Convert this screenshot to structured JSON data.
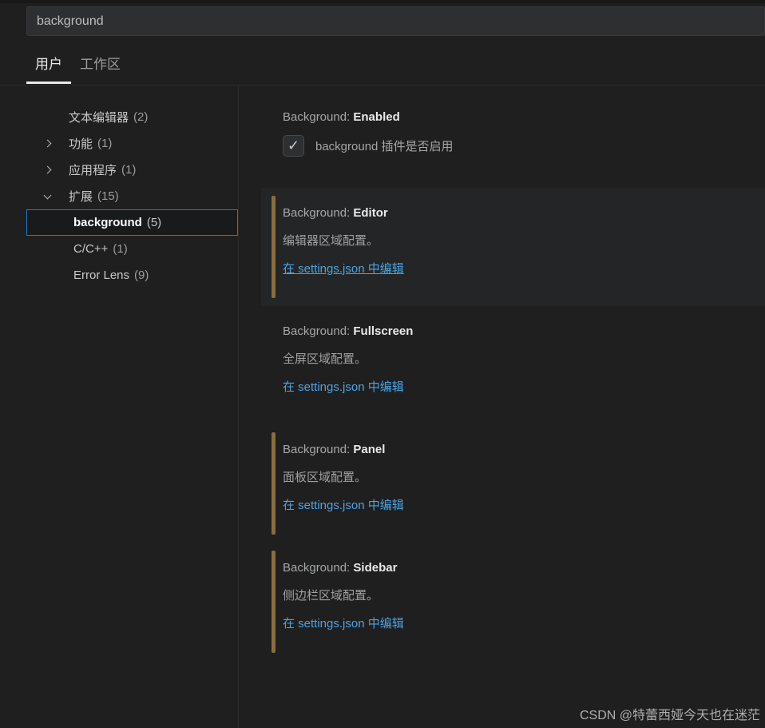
{
  "search": {
    "value": "background"
  },
  "tabs": [
    {
      "label": "用户",
      "active": true
    },
    {
      "label": "工作区",
      "active": false
    }
  ],
  "toc": {
    "items": [
      {
        "label": "文本编辑器",
        "count": "(2)",
        "chevron": "none",
        "level": 0,
        "selected": false
      },
      {
        "label": "功能",
        "count": "(1)",
        "chevron": "right",
        "level": 0,
        "selected": false
      },
      {
        "label": "应用程序",
        "count": "(1)",
        "chevron": "right",
        "level": 0,
        "selected": false
      },
      {
        "label": "扩展",
        "count": "(15)",
        "chevron": "down",
        "level": 0,
        "selected": false
      },
      {
        "label": "background",
        "count": "(5)",
        "chevron": "none",
        "level": 1,
        "selected": true
      },
      {
        "label": "C/C++",
        "count": "(1)",
        "chevron": "none",
        "level": 1,
        "selected": false
      },
      {
        "label": "Error Lens",
        "count": "(9)",
        "chevron": "none",
        "level": 1,
        "selected": false
      }
    ]
  },
  "settings": [
    {
      "category": "Background: ",
      "name": "Enabled",
      "type": "checkbox",
      "checkbox_label": "background 插件是否启用",
      "checked": true,
      "check_glyph": "✓",
      "modified": false,
      "focused": false
    },
    {
      "category": "Background: ",
      "name": "Editor",
      "type": "link",
      "description": "编辑器区域配置。",
      "link_label": "在 settings.json 中编辑",
      "modified": true,
      "focused": true
    },
    {
      "category": "Background: ",
      "name": "Fullscreen",
      "type": "link",
      "description": "全屏区域配置。",
      "link_label": "在 settings.json 中编辑",
      "modified": false,
      "focused": false
    },
    {
      "category": "Background: ",
      "name": "Panel",
      "type": "link",
      "description": "面板区域配置。",
      "link_label": "在 settings.json 中编辑",
      "modified": true,
      "focused": false
    },
    {
      "category": "Background: ",
      "name": "Sidebar",
      "type": "link",
      "description": "侧边栏区域配置。",
      "link_label": "在 settings.json 中编辑",
      "modified": true,
      "focused": false
    }
  ],
  "watermark": "CSDN @特蕾西娅今天也在迷茫",
  "colors": {
    "accent-link": "#4ba3e0",
    "modified-bar": "#8a6d3a",
    "focus-border": "#2577c8",
    "tab-underline": "#e9e9e9"
  }
}
